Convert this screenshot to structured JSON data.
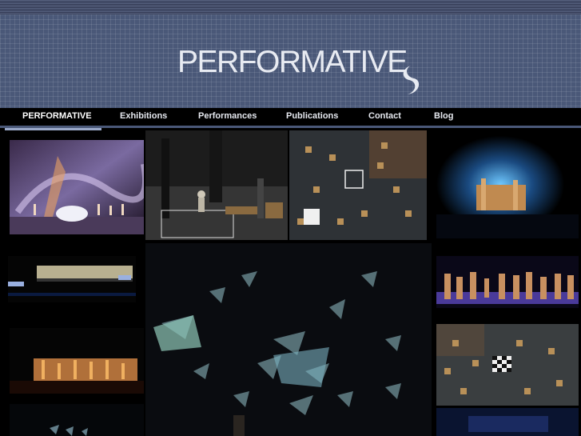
{
  "header": {
    "logo_text": "PERFORMATIVE",
    "background_color": "#4a5878"
  },
  "nav": {
    "items": [
      {
        "label": "PERFORMATIVE",
        "active": true
      },
      {
        "label": "Exhibitions"
      },
      {
        "label": "Performances"
      },
      {
        "label": "Publications"
      },
      {
        "label": "Contact"
      },
      {
        "label": "Blog"
      }
    ]
  },
  "gallery": {
    "photos": [
      "stage-dance-colorful-lights",
      "rehearsal-stage-wide",
      "aerial-stage-with-boxes",
      "blue-lit-stage-sculpture",
      "dark-stage-lit-wall",
      "projected-butterflies-large",
      "stage-pillars-purple-light",
      "orange-lit-installation",
      "aerial-checkerboard-stage",
      "projected-shapes-bottom"
    ]
  }
}
